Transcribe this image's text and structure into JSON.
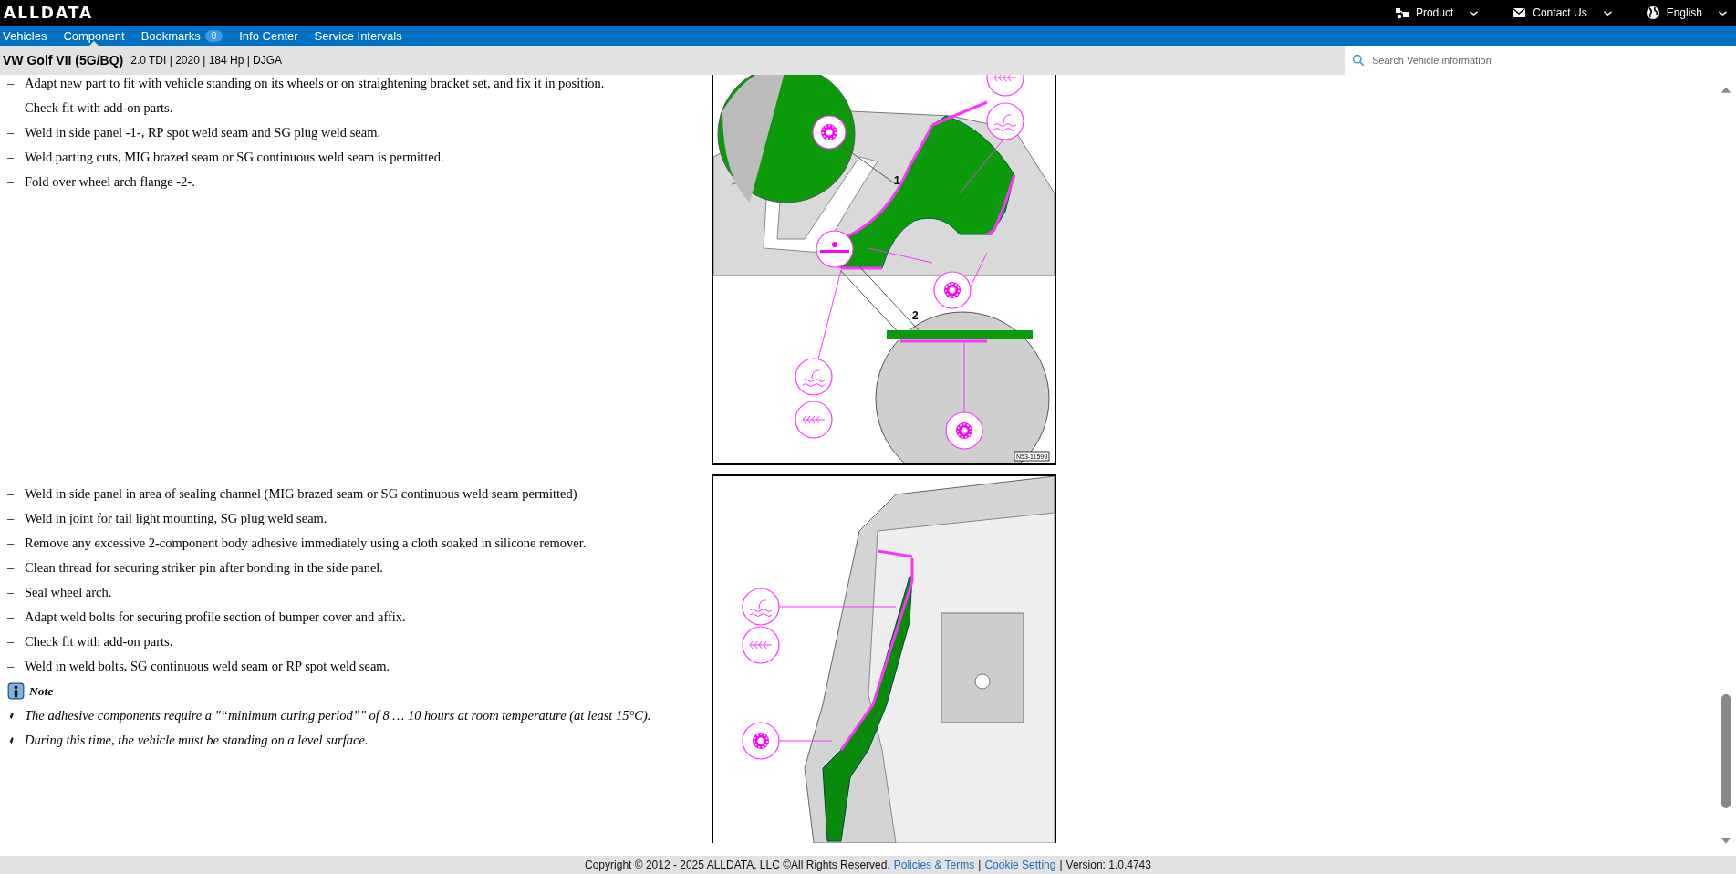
{
  "top_bar": {
    "logo": "ALLDATA",
    "menus": [
      {
        "kind": "product",
        "label": "Product"
      },
      {
        "kind": "contact",
        "label": "Contact Us"
      },
      {
        "kind": "language",
        "label": "English"
      }
    ]
  },
  "nav": {
    "tabs": [
      {
        "label": "Vehicles",
        "selected": false
      },
      {
        "label": "Component",
        "selected": true
      },
      {
        "label": "Bookmarks",
        "badge": "0",
        "selected": false
      },
      {
        "label": "Info Center",
        "selected": false
      },
      {
        "label": "Service Intervals",
        "selected": false
      }
    ]
  },
  "vehicle_bar": {
    "title": "VW Golf VII (5G/BQ)",
    "details": "2.0 TDI | 2020 | 184 Hp | DJGA",
    "search": {
      "placeholder": "Search Vehicle information"
    }
  },
  "sections": [
    {
      "steps": [
        {
          "marker": "–",
          "text": "Adapt new part to fit with vehicle standing on its wheels or on straightening bracket set, and fix it in position."
        },
        {
          "marker": "–",
          "text": "Check fit with add-on parts."
        },
        {
          "marker": "–",
          "text": "Weld in side panel -1-, RP spot weld seam and SG plug weld seam."
        },
        {
          "marker": "–",
          "text": "Weld parting cuts, MIG brazed seam or SG continuous weld seam is permitted."
        },
        {
          "marker": "–",
          "text": "Fold over wheel arch flange -2-."
        }
      ],
      "figure": {
        "kind": "side_panel",
        "callouts": [
          "1",
          "2"
        ],
        "image_id": "N53-11599"
      }
    },
    {
      "steps": [
        {
          "marker": "–",
          "text": "Weld in side panel in area of sealing channel (MIG brazed seam or SG continuous weld seam permitted)"
        },
        {
          "marker": "–",
          "text": "Weld in joint for tail light mounting, SG plug weld seam."
        },
        {
          "marker": "–",
          "text": "Remove any excessive 2-component body adhesive immediately using a cloth soaked in silicone remover."
        },
        {
          "marker": "–",
          "text": "Clean thread for securing striker pin after bonding in the side panel."
        },
        {
          "marker": "–",
          "text": "Seal wheel arch."
        },
        {
          "marker": "–",
          "text": "Adapt weld bolts for securing profile section of bumper cover and affix."
        },
        {
          "marker": "–",
          "text": "Check fit with add-on parts."
        },
        {
          "marker": "–",
          "text": "Weld in weld bolts, SG continuous weld seam or RP spot weld seam."
        }
      ],
      "note": {
        "title": "Note",
        "items": [
          "The adhesive components require a \"“minimum curing period”\" of 8 … 10 hours at room temperature (at least 15°C).",
          "During this time, the vehicle must be standing on a level surface."
        ]
      },
      "figure": {
        "kind": "rear_corner"
      }
    }
  ],
  "footer": {
    "parts": [
      {
        "kind": "text",
        "text": "Copyright © 2012 - 2025 ALLDATA, LLC ©All Rights Reserved."
      },
      {
        "kind": "link",
        "text": "Policies & Terms"
      },
      {
        "kind": "separator",
        "text": "|"
      },
      {
        "kind": "link",
        "text": "Cookie Setting"
      },
      {
        "kind": "separator",
        "text": "|"
      },
      {
        "kind": "text",
        "text": "Version: 1.0.4743"
      }
    ]
  }
}
